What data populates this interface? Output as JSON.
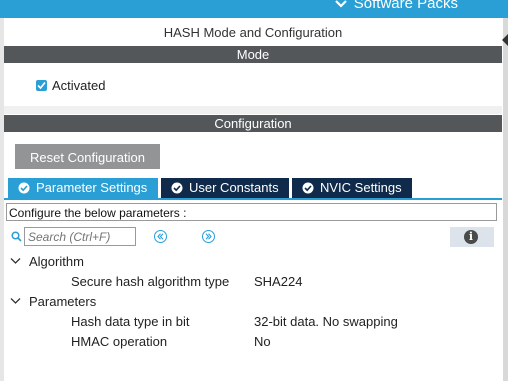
{
  "topbar": {
    "label": "Software Packs"
  },
  "panel": {
    "title": "HASH Mode and Configuration"
  },
  "mode": {
    "header": "Mode",
    "activated_label": "Activated",
    "activated": true
  },
  "configuration": {
    "header": "Configuration",
    "reset_label": "Reset Configuration",
    "tabs": [
      {
        "label": "Parameter Settings",
        "active": true
      },
      {
        "label": "User Constants",
        "active": false
      },
      {
        "label": "NVIC Settings",
        "active": false
      }
    ],
    "instructions": "Configure the below parameters :",
    "search": {
      "placeholder": "Search (Ctrl+F)"
    },
    "groups": [
      {
        "name": "Algorithm",
        "params": [
          {
            "name": "Secure hash algorithm type",
            "value": "SHA224"
          }
        ]
      },
      {
        "name": "Parameters",
        "params": [
          {
            "name": "Hash data type in bit",
            "value": "32-bit data. No swapping"
          },
          {
            "name": "HMAC operation",
            "value": "No"
          }
        ]
      }
    ]
  },
  "colors": {
    "accent": "#2a9fd6",
    "band": "#53575a",
    "tab_dark": "#0f2a4a",
    "button_gray": "#929496"
  },
  "icons": [
    "chevron-down-icon",
    "check-icon",
    "check-circle-icon",
    "search-icon",
    "arrow-left-icon",
    "arrow-right-icon",
    "info-icon",
    "caret-down-icon"
  ]
}
